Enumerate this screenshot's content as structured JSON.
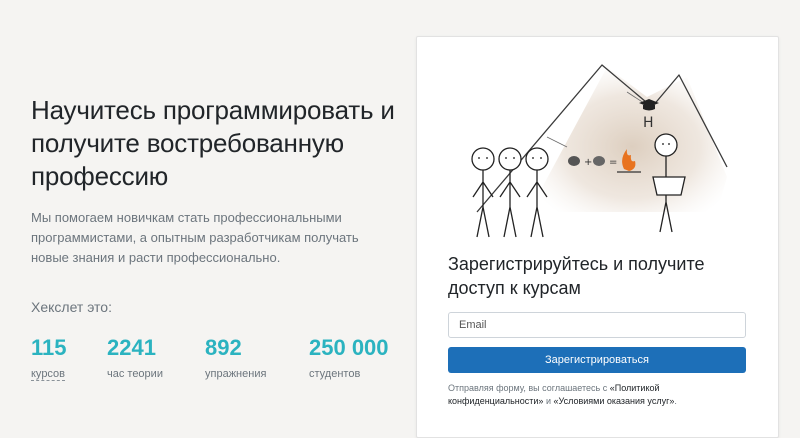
{
  "hero": {
    "headline": "Научитесь программировать и получите востребованную профессию",
    "lead": "Мы помогаем новичкам стать профессиональными программистами, а опытным разработчикам получать новые знания и расти профессионально."
  },
  "stats": {
    "title": "Хекслет это:",
    "items": [
      {
        "value": "115",
        "label": "курсов"
      },
      {
        "value": "2241",
        "label": "час теории"
      },
      {
        "value": "892",
        "label": "упражнения"
      },
      {
        "value": "250 000",
        "label": "студентов"
      }
    ]
  },
  "signup": {
    "title": "Зарегистрируйтесь и получите доступ к курсам",
    "email_placeholder": "Email",
    "submit_label": "Зарегистрироваться",
    "terms_prefix": "Отправляя форму, вы соглашаетесь с",
    "privacy_link": "«Политикой конфиденциальности»",
    "terms_and": "и",
    "service_link": "«Условиями оказания услуг»",
    "terms_suffix": ".",
    "illustration_letter": "H"
  },
  "colors": {
    "accent": "#2bb3c0",
    "button": "#1d6fb8",
    "background": "#f5f4f2"
  }
}
